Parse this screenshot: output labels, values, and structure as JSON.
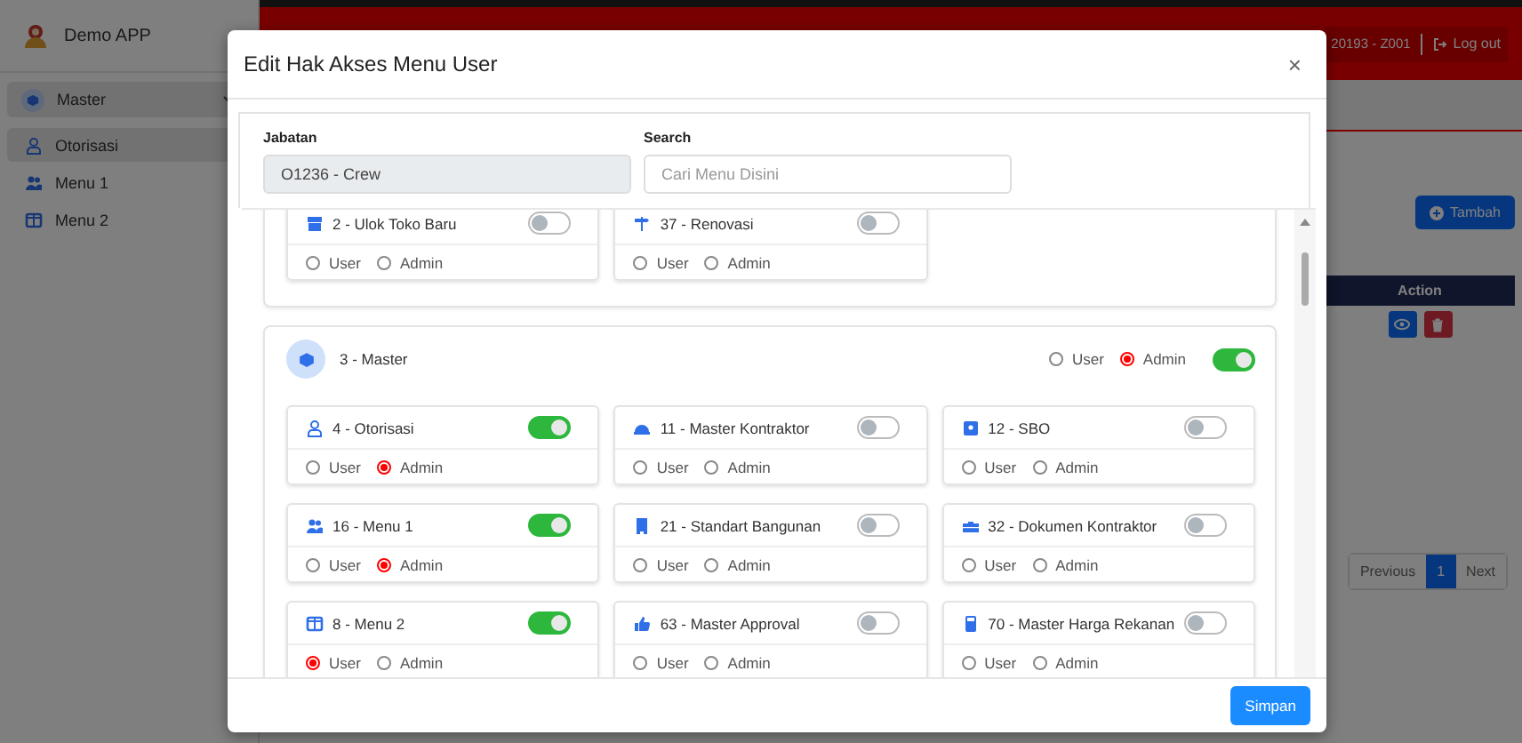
{
  "sidebar": {
    "brand": "Demo APP",
    "items": [
      {
        "label": "Master",
        "expanded": true,
        "children": [
          {
            "label": "Otorisasi",
            "selected": true
          },
          {
            "label": "Menu 1",
            "selected": false
          },
          {
            "label": "Menu 2",
            "selected": false
          }
        ]
      }
    ]
  },
  "topbar": {
    "user": "20193 - Z001",
    "logout": "Log out"
  },
  "content": {
    "add_button": "Tambah",
    "table": {
      "columns": [
        "Action"
      ]
    },
    "pagination": [
      {
        "label": "Previous",
        "selected": false
      },
      {
        "label": "1",
        "selected": true
      },
      {
        "label": "Next",
        "selected": false
      }
    ]
  },
  "modal": {
    "title": "Edit Hak Akses Menu User",
    "close": "×",
    "jabatan": {
      "label": "Jabatan",
      "value": "O1236 - Crew"
    },
    "search": {
      "label": "Search",
      "placeholder": "Cari Menu Disini"
    },
    "groups": [
      {
        "items": [
          {
            "label": "2 - Ulok Toko Baru",
            "on": false,
            "roles": [
              {
                "label": "User",
                "selected": false
              },
              {
                "label": "Admin",
                "selected": false
              }
            ]
          },
          {
            "label": "37 - Renovasi",
            "on": false,
            "roles": [
              {
                "label": "User",
                "selected": false
              },
              {
                "label": "Admin",
                "selected": false
              }
            ]
          }
        ]
      },
      {
        "label": "3 - Master",
        "on": true,
        "roles": [
          {
            "label": "User",
            "selected": false
          },
          {
            "label": "Admin",
            "selected": true
          }
        ],
        "items": [
          {
            "label": "4 - Otorisasi",
            "on": true,
            "roles": [
              {
                "label": "User",
                "selected": false
              },
              {
                "label": "Admin",
                "selected": true
              }
            ]
          },
          {
            "label": "11 - Master Kontraktor",
            "on": false,
            "roles": [
              {
                "label": "User",
                "selected": false
              },
              {
                "label": "Admin",
                "selected": false
              }
            ]
          },
          {
            "label": "12 - SBO",
            "on": false,
            "roles": [
              {
                "label": "User",
                "selected": false
              },
              {
                "label": "Admin",
                "selected": false
              }
            ]
          },
          {
            "label": "16 - Menu 1",
            "on": true,
            "roles": [
              {
                "label": "User",
                "selected": false
              },
              {
                "label": "Admin",
                "selected": true
              }
            ]
          },
          {
            "label": "21 - Standart Bangunan",
            "on": false,
            "roles": [
              {
                "label": "User",
                "selected": false
              },
              {
                "label": "Admin",
                "selected": false
              }
            ]
          },
          {
            "label": "32 - Dokumen Kontraktor",
            "on": false,
            "roles": [
              {
                "label": "User",
                "selected": false
              },
              {
                "label": "Admin",
                "selected": false
              }
            ]
          },
          {
            "label": "8 - Menu 2",
            "on": true,
            "roles": [
              {
                "label": "User",
                "selected": true
              },
              {
                "label": "Admin",
                "selected": false
              }
            ]
          },
          {
            "label": "63 - Master Approval",
            "on": false,
            "roles": [
              {
                "label": "User",
                "selected": false
              },
              {
                "label": "Admin",
                "selected": false
              }
            ]
          },
          {
            "label": "70 - Master Harga Rekanan",
            "on": false,
            "roles": [
              {
                "label": "User",
                "selected": false
              },
              {
                "label": "Admin",
                "selected": false
              }
            ]
          }
        ]
      }
    ],
    "save": "Simpan"
  }
}
